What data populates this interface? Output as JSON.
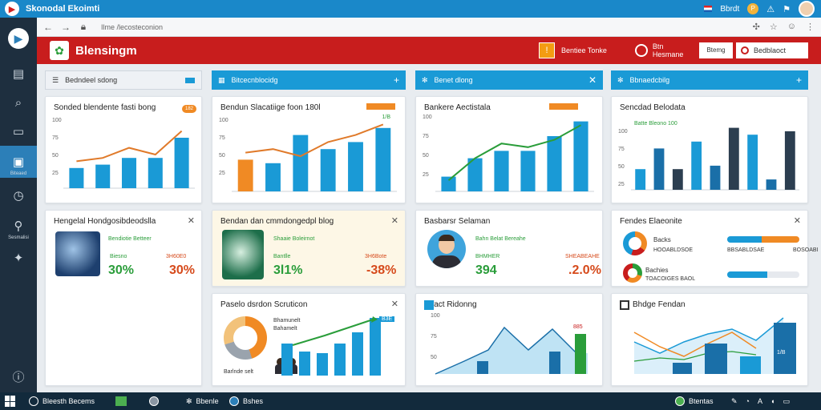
{
  "window": {
    "title": "Skonodal Ekoimti"
  },
  "browser": {
    "url": "Ilme /lecosteconion"
  },
  "header": {
    "brand": "Blensingm",
    "btn1": "Bentiee Tonke",
    "btn2": "Btn Hesmane",
    "btn3": "Btemg",
    "btn4": "Bedblaoct"
  },
  "topbar": {
    "item1": "Bbrdt",
    "coin": "P"
  },
  "rail": {
    "items": [
      "",
      "",
      "",
      "",
      "Biteaed",
      "",
      "Sesmalisi",
      "",
      ""
    ]
  },
  "sections": [
    {
      "label": "Bedndeel sdong"
    },
    {
      "label": "Bitcecnblocidg"
    },
    {
      "label": "Benet dlong"
    },
    {
      "label": "Bbnaedcbilg"
    }
  ],
  "cards": {
    "c1": {
      "title": "Sonded blendente fasti bong",
      "badge": "182"
    },
    "c2": {
      "title": "Bendun Slacatiige foon 180l",
      "badge": "1/B"
    },
    "c3": {
      "title": "Bankere Aectistala"
    },
    "c4": {
      "title": "Sencdad Belodata",
      "legend": "Batte Bleono 100"
    },
    "c5": {
      "title": "Hengelal Hondgosibdeodslla",
      "sub": "Bendiotie Betteer",
      "l_label": "Biesno",
      "r_label": "3H60E0",
      "l_val": "30%",
      "r_val": "30%"
    },
    "c6": {
      "title": "Bendan dan cmmdongedpl blog",
      "sub": "Shaaie Boleirnot",
      "l_label": "Bantlle",
      "r_label": "3H6Bote",
      "l_val": "3l1%",
      "r_val": "-38%"
    },
    "c7": {
      "title": "Basbarsr Selaman",
      "sub": "Bahn Belat Bereahe",
      "l_label": "BHMHER",
      "r_label": "SHEABEAHE",
      "l_val": "394",
      "r_val": ".2.0%"
    },
    "c8": {
      "title": "Fendes Elaeonite",
      "r1": "Backs",
      "r1s": "HOOABLDSOE",
      "r2": "Bachies",
      "r2s": "TOACOIGES BAOL",
      "p1": "BBSABLDSAE",
      "p2": "BOSOABI"
    },
    "c9": {
      "title": "Paselo dsrdon Scruticon",
      "donut1": "Bhamunelt",
      "donut2": "Bahamelt",
      "foot": "Barlnde selt",
      "badge": "B3E"
    },
    "c10": {
      "title": "Difact Ridonng",
      "badge": "885"
    },
    "c11": {
      "title": "Bhdge Fendan",
      "badge": "1/B"
    }
  },
  "axis": {
    "c1": [
      "100",
      "75",
      "50",
      "25",
      "0"
    ],
    "c1x": [
      "Baa",
      "Bab",
      "Bac",
      "Bad",
      "Bae"
    ],
    "c2": [
      "100",
      "75",
      "50",
      "25",
      "0"
    ],
    "c3": [
      "100",
      "75",
      "50",
      "25",
      "0"
    ],
    "c4": [
      "100",
      "75",
      "50",
      "25"
    ],
    "c10": [
      "100",
      "75",
      "50"
    ]
  },
  "taskbar": {
    "start": "Bleesth Becems",
    "t2": "Bbenle",
    "t3": "Bshes",
    "tray1": "Btentas",
    "clock": "A"
  },
  "colors": {
    "red": "#c81d1d",
    "blue": "#1a9ad6",
    "orange": "#f08a24",
    "green": "#2a9d3a"
  },
  "chart_data": [
    {
      "type": "bar",
      "title": "Sonded blendente fasti bong",
      "values": [
        30,
        35,
        45,
        45,
        75
      ],
      "trend": [
        40,
        45,
        60,
        50,
        85
      ]
    },
    {
      "type": "bar",
      "title": "Bendun Slacatiige foon 180l",
      "values": [
        45,
        40,
        80,
        60,
        70,
        90
      ],
      "trend": [
        55,
        60,
        50,
        70,
        80,
        95
      ]
    },
    {
      "type": "bar",
      "title": "Bankere Aectistala",
      "values": [
        20,
        45,
        55,
        55,
        75,
        95
      ],
      "trend": [
        15,
        45,
        65,
        60,
        70,
        90
      ]
    },
    {
      "type": "bar",
      "title": "Sencdad Belodata",
      "values": [
        30,
        60,
        30,
        70,
        35,
        90,
        80,
        15,
        85
      ]
    }
  ]
}
